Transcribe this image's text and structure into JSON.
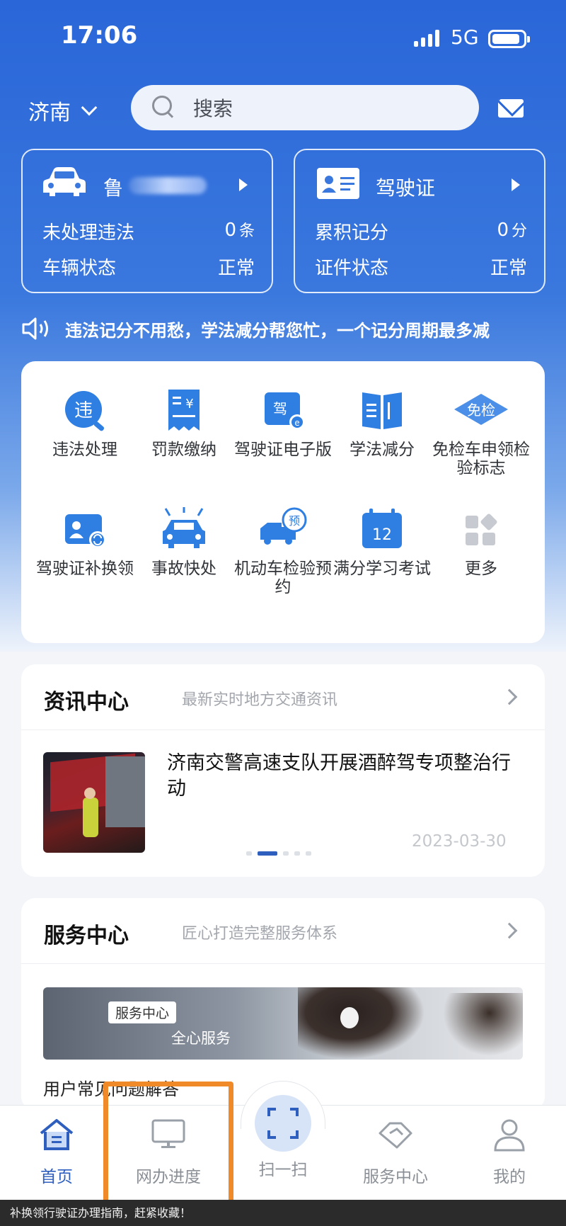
{
  "status_bar": {
    "time": "17:06",
    "network": "5G"
  },
  "header": {
    "city": "济南",
    "search_placeholder": "搜索"
  },
  "vehicle_card": {
    "plate": "鲁",
    "rows": [
      {
        "label": "未处理违法",
        "value": "0",
        "unit": "条"
      },
      {
        "label": "车辆状态",
        "value": "正常",
        "unit": ""
      }
    ]
  },
  "license_card": {
    "title": "驾驶证",
    "rows": [
      {
        "label": "累积记分",
        "value": "0",
        "unit": "分"
      },
      {
        "label": "证件状态",
        "value": "正常",
        "unit": ""
      }
    ]
  },
  "notice": {
    "text": "违法记分不用愁，学法减分帮您忙，一个记分周期最多减"
  },
  "services": [
    {
      "label": "违法处理",
      "icon": "violation-icon"
    },
    {
      "label": "罚款缴纳",
      "icon": "fine-receipt-icon"
    },
    {
      "label": "驾驶证电子版",
      "icon": "e-license-icon"
    },
    {
      "label": "学法减分",
      "icon": "book-icon"
    },
    {
      "label": "免检车申领检验标志",
      "icon": "inspection-free-icon"
    },
    {
      "label": "驾驶证补换领",
      "icon": "license-renew-icon"
    },
    {
      "label": "事故快处",
      "icon": "accident-icon"
    },
    {
      "label": "机动车检验预约",
      "icon": "inspection-booking-icon"
    },
    {
      "label": "满分学习考试",
      "icon": "calendar-12-icon"
    },
    {
      "label": "更多",
      "icon": "more-grid-icon"
    }
  ],
  "news": {
    "title": "资讯中心",
    "subtitle": "最新实时地方交通资讯",
    "item_title": "济南交警高速支队开展酒醉驾专项整治行动",
    "item_date": "2023-03-30"
  },
  "service_center": {
    "title": "服务中心",
    "subtitle": "匠心打造完整服务体系",
    "banner_tag": "服务中心",
    "banner_text": "全心服务",
    "faq": "用户常见问题解答"
  },
  "tabs": [
    {
      "label": "首页",
      "icon": "home-icon",
      "active": true
    },
    {
      "label": "网办进度",
      "icon": "monitor-icon",
      "active": false
    },
    {
      "label": "扫一扫",
      "icon": "scan-icon",
      "active": false
    },
    {
      "label": "服务中心",
      "icon": "handshake-icon",
      "active": false
    },
    {
      "label": "我的",
      "icon": "user-icon",
      "active": false
    }
  ],
  "caption": "补换领行驶证办理指南，赶紧收藏！",
  "colors": {
    "brand_blue": "#2a66d8",
    "active_tab": "#2e5fbf",
    "highlight": "#f08a28"
  }
}
